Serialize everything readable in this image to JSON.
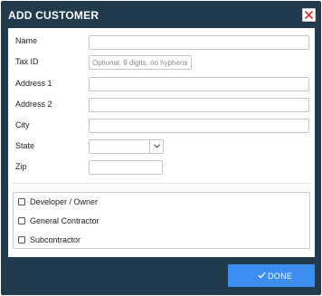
{
  "dialog": {
    "title": "ADD CUSTOMER",
    "close_icon": "close-x-icon"
  },
  "form": {
    "name": {
      "label": "Name",
      "value": ""
    },
    "tax_id": {
      "label": "Tax ID",
      "value": "",
      "placeholder": "Optional, 9 digits, no hyphens"
    },
    "address1": {
      "label": "Address 1",
      "value": ""
    },
    "address2": {
      "label": "Address 2",
      "value": ""
    },
    "city": {
      "label": "City",
      "value": ""
    },
    "state": {
      "label": "State",
      "value": "",
      "dropdown_icon": "chevron-down-icon"
    },
    "zip": {
      "label": "Zip",
      "value": ""
    }
  },
  "roles": [
    {
      "label": "Developer / Owner",
      "checked": false
    },
    {
      "label": "General Contractor",
      "checked": false
    },
    {
      "label": "Subcontractor",
      "checked": false
    }
  ],
  "footer": {
    "done_label": "DONE",
    "done_icon": "checkmark-icon"
  },
  "colors": {
    "frame": "#1f3b4d",
    "primary": "#3d8ef0",
    "close_x": "#d0322e"
  }
}
